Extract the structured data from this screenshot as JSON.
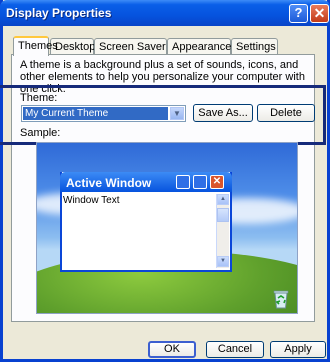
{
  "window": {
    "title": "Display Properties"
  },
  "tabs": [
    "Themes",
    "Desktop",
    "Screen Saver",
    "Appearance",
    "Settings"
  ],
  "description": "A theme is a background plus a set of sounds, icons, and other elements to help you personalize your computer with one click.",
  "theme": {
    "label": "Theme:",
    "selected": "My Current Theme",
    "save_as": "Save As...",
    "delete": "Delete"
  },
  "sample": {
    "label": "Sample:",
    "window_title": "Active Window",
    "window_text": "Window Text"
  },
  "footer": {
    "ok": "OK",
    "cancel": "Cancel",
    "apply": "Apply"
  },
  "colors": {
    "titlebar": "#0653de",
    "face": "#ece9d8",
    "highlight_box": "#162a7a",
    "selection": "#316ac5"
  },
  "icons": [
    "help-icon",
    "close-icon",
    "chevron-down-icon",
    "minimize-icon",
    "maximize-icon",
    "close-icon",
    "scroll-up-icon",
    "scroll-down-icon",
    "recycle-bin-icon"
  ]
}
